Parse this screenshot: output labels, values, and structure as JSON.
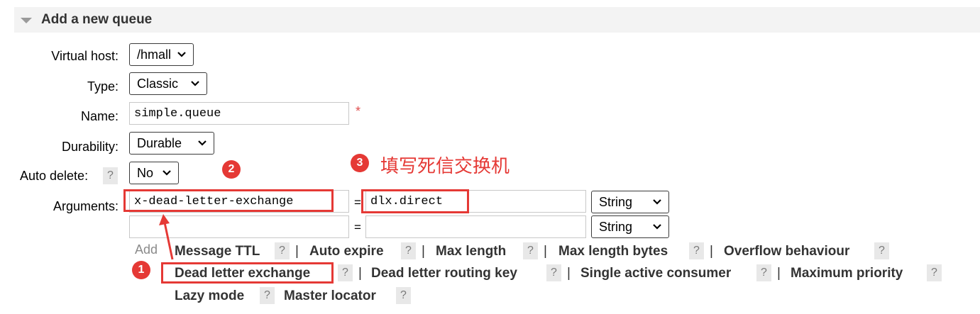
{
  "section": {
    "title": "Add a new queue"
  },
  "form": {
    "virtual_host": {
      "label": "Virtual host:",
      "value": "/hmall"
    },
    "type": {
      "label": "Type:",
      "value": "Classic"
    },
    "name": {
      "label": "Name:",
      "value": "simple.queue",
      "required_mark": "*"
    },
    "durability": {
      "label": "Durability:",
      "value": "Durable"
    },
    "auto_delete": {
      "label": "Auto delete:",
      "help": "?",
      "value": "No"
    },
    "arguments": {
      "label": "Arguments:",
      "rows": [
        {
          "key": "x-dead-letter-exchange",
          "eq": "=",
          "value": "dlx.direct",
          "type": "String"
        },
        {
          "key": "",
          "eq": "=",
          "value": "",
          "type": "String"
        }
      ],
      "add_label": "Add"
    }
  },
  "shortcuts": {
    "help": "?",
    "separator": "|",
    "items": [
      "Message TTL",
      "Auto expire",
      "Max length",
      "Max length bytes",
      "Overflow behaviour",
      "Dead letter exchange",
      "Dead letter routing key",
      "Single active consumer",
      "Maximum priority",
      "Lazy mode",
      "Master locator"
    ]
  },
  "annotations": {
    "markers": [
      "1",
      "2",
      "3"
    ],
    "note": "填写死信交换机",
    "color": "#e53935"
  }
}
